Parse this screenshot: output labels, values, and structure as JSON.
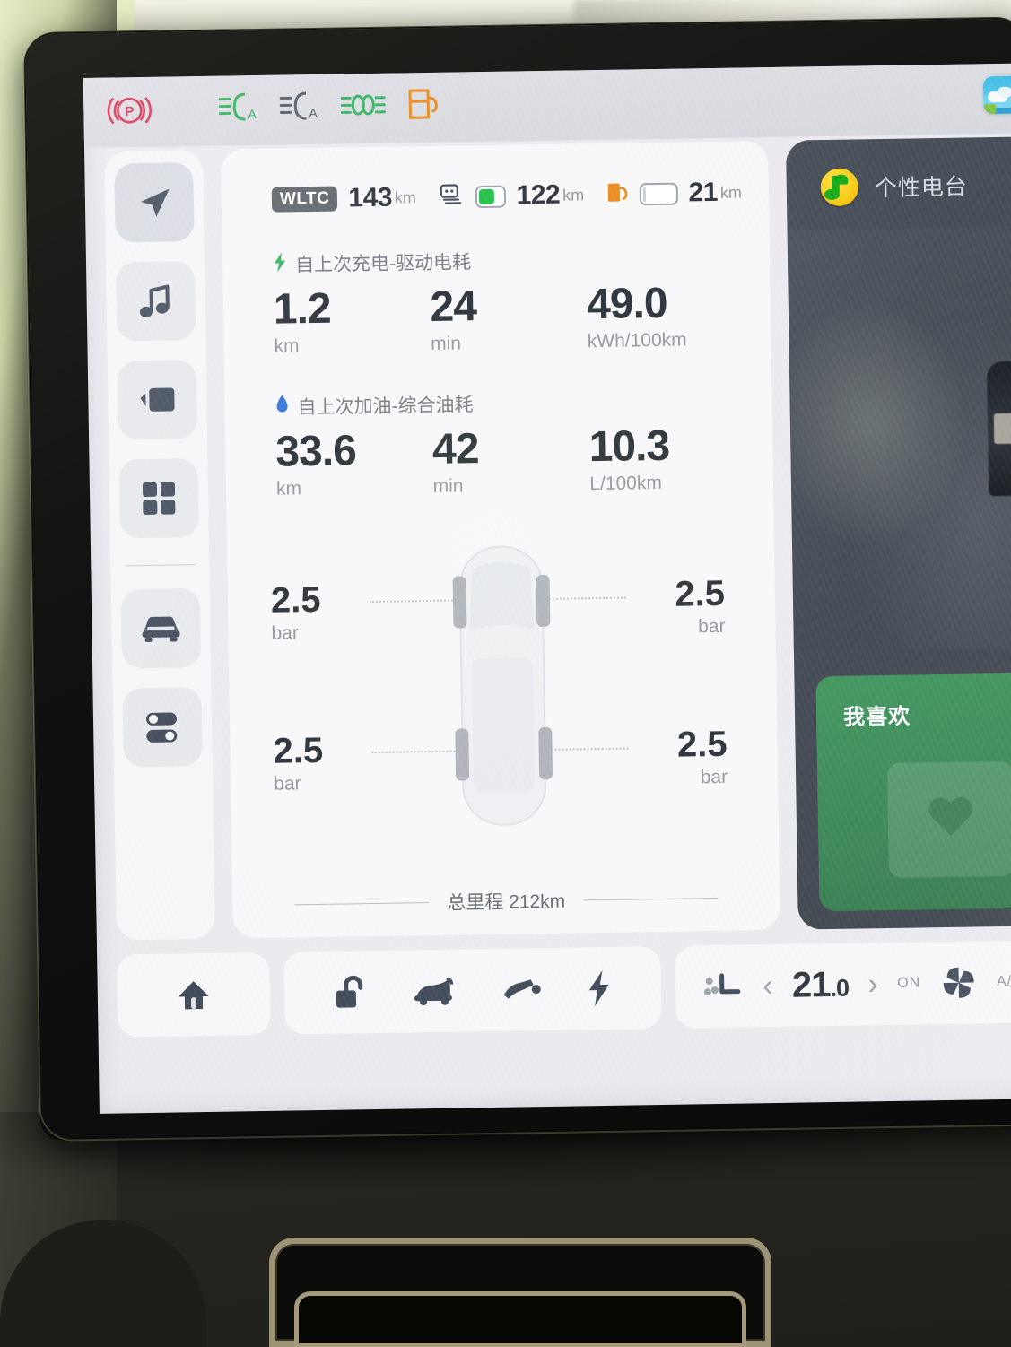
{
  "status_bar": {
    "indicators": [
      {
        "name": "parking-brake-indicator",
        "label": "P",
        "color": "#d9294a"
      },
      {
        "name": "auto-low-beam-indicator",
        "label": "A",
        "color": "#2fae57"
      },
      {
        "name": "auto-high-beam-indicator",
        "label": "A",
        "color": "#4d5663"
      },
      {
        "name": "position-lamp-indicator",
        "label": "",
        "color": "#2fae57"
      },
      {
        "name": "fuel-cap-indicator",
        "label": "",
        "color": "#e8871f"
      }
    ],
    "weather_app_icon": "weather-icon"
  },
  "sidebar": {
    "items": [
      {
        "name": "sidebar-item-navigation",
        "icon": "navigation-arrow-icon",
        "active": true
      },
      {
        "name": "sidebar-item-music",
        "icon": "music-note-icon",
        "active": false
      },
      {
        "name": "sidebar-item-video",
        "icon": "video-camera-icon",
        "active": false
      },
      {
        "name": "sidebar-item-apps",
        "icon": "apps-grid-icon",
        "active": false
      },
      {
        "name": "sidebar-item-vehicle",
        "icon": "car-front-icon",
        "active": false
      },
      {
        "name": "sidebar-item-settings",
        "icon": "toggles-icon",
        "active": false
      }
    ]
  },
  "energy_card": {
    "range_row": [
      {
        "badge": "WLTC",
        "value": "143",
        "unit": "km",
        "type": "badge"
      },
      {
        "icon": "battery-icon",
        "value": "122",
        "unit": "km",
        "type": "battery",
        "fill_percent": 62,
        "fill_color": "#22bb45"
      },
      {
        "icon": "fuel-pump-icon",
        "value": "21",
        "unit": "km",
        "type": "fuel",
        "fill_percent": 6,
        "fill_color": "#c9ccd3"
      }
    ],
    "sections": [
      {
        "name": "electric-consumption-section",
        "icon": "lightning-bolt-icon",
        "icon_color": "#2fae57",
        "title": "自上次充电-驱动电耗",
        "metrics": [
          {
            "value": "1.2",
            "unit": "km"
          },
          {
            "value": "24",
            "unit": "min"
          },
          {
            "value": "49.0",
            "unit": "kWh/100km"
          }
        ]
      },
      {
        "name": "fuel-consumption-section",
        "icon": "fuel-drop-icon",
        "icon_color": "#2b6fd6",
        "title": "自上次加油-综合油耗",
        "metrics": [
          {
            "value": "33.6",
            "unit": "km"
          },
          {
            "value": "42",
            "unit": "min"
          },
          {
            "value": "10.3",
            "unit": "L/100km"
          }
        ]
      }
    ],
    "tire_pressure": {
      "front_left": {
        "value": "2.5",
        "unit": "bar"
      },
      "front_right": {
        "value": "2.5",
        "unit": "bar"
      },
      "rear_left": {
        "value": "2.5",
        "unit": "bar"
      },
      "rear_right": {
        "value": "2.5",
        "unit": "bar"
      }
    },
    "odometer": "总里程 212km"
  },
  "media_panel": {
    "app_icon": "qq-music-icon",
    "title": "个性电台",
    "favorite_card": {
      "title": "我喜欢",
      "art_icon": "heart-icon",
      "color": "#358150"
    }
  },
  "dock": {
    "home": {
      "name": "home-button",
      "icon": "home-icon"
    },
    "quick_actions": [
      {
        "name": "unlock-button",
        "icon": "unlock-icon"
      },
      {
        "name": "trunk-button",
        "icon": "trunk-icon"
      },
      {
        "name": "fuel-flap-button",
        "icon": "fuel-nozzle-icon"
      },
      {
        "name": "charge-port-button",
        "icon": "lightning-bolt-icon"
      }
    ],
    "climate": {
      "seat_icon": "seat-heater-icon",
      "prev_label": "‹",
      "temperature_int": "21",
      "temperature_dec": ".0",
      "next_label": "›",
      "fan_state": "ON",
      "fan_icon": "fan-icon",
      "ac_label": "A/C"
    }
  }
}
